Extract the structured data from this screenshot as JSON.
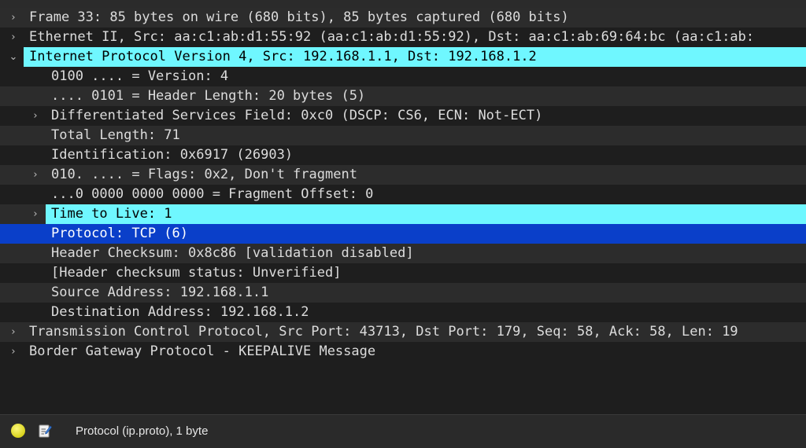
{
  "packet_details": {
    "rows": [
      {
        "label": "Frame 33: 85 bytes on wire (680 bits), 85 bytes captured (680 bits)"
      },
      {
        "label": "Ethernet II, Src: aa:c1:ab:d1:55:92 (aa:c1:ab:d1:55:92), Dst: aa:c1:ab:69:64:bc (aa:c1:ab:"
      },
      {
        "label": "Internet Protocol Version 4, Src: 192.168.1.1, Dst: 192.168.1.2"
      },
      {
        "label": "0100 .... = Version: 4"
      },
      {
        "label": ".... 0101 = Header Length: 20 bytes (5)"
      },
      {
        "label": "Differentiated Services Field: 0xc0 (DSCP: CS6, ECN: Not-ECT)"
      },
      {
        "label": "Total Length: 71"
      },
      {
        "label": "Identification: 0x6917 (26903)"
      },
      {
        "label": "010. .... = Flags: 0x2, Don't fragment"
      },
      {
        "label": "...0 0000 0000 0000 = Fragment Offset: 0"
      },
      {
        "label": "Time to Live: 1"
      },
      {
        "label": "Protocol: TCP (6)"
      },
      {
        "label": "Header Checksum: 0x8c86 [validation disabled]"
      },
      {
        "label": "[Header checksum status: Unverified]"
      },
      {
        "label": "Source Address: 192.168.1.1"
      },
      {
        "label": "Destination Address: 192.168.1.2"
      },
      {
        "label": "Transmission Control Protocol, Src Port: 43713, Dst Port: 179, Seq: 58, Ack: 58, Len: 19"
      },
      {
        "label": "Border Gateway Protocol - KEEPALIVE Message"
      }
    ],
    "expanded_arrow": "⌄",
    "collapsed_arrow": "›"
  },
  "status_bar": {
    "text": "Protocol (ip.proto), 1 byte",
    "indicator_icon": "yellow-status-dot-icon",
    "edit_icon": "edit-note-icon"
  },
  "colors": {
    "background": "#1e1e1e",
    "highlight": "#6ff7ff",
    "selection": "#0a3fc9",
    "text": "#dcdcdc"
  }
}
